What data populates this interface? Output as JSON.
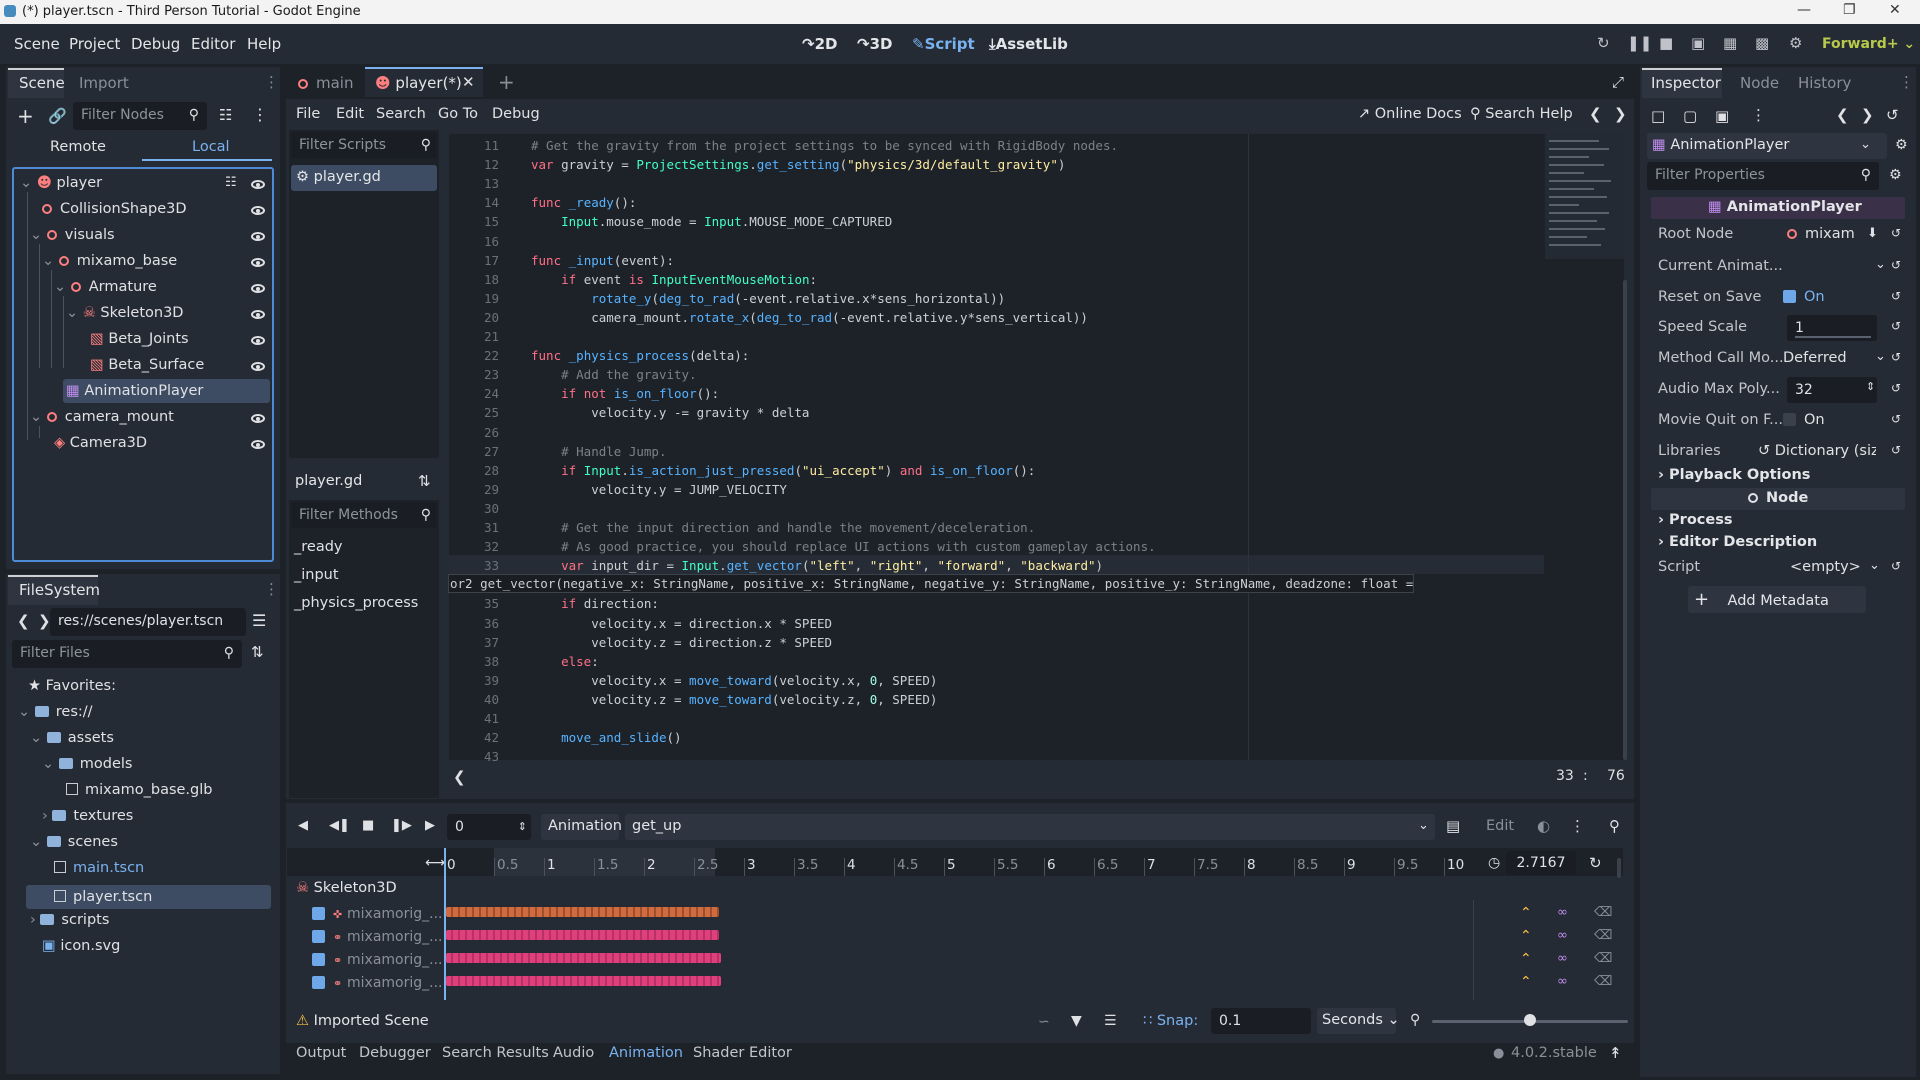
{
  "window": {
    "title": "(*) player.tscn - Third Person Tutorial - Godot Engine"
  },
  "menu": [
    "Scene",
    "Project",
    "Debug",
    "Editor",
    "Help"
  ],
  "workspaces": [
    "2D",
    "3D",
    "Script",
    "AssetLib"
  ],
  "renderer": "Forward+",
  "scene_dock": {
    "tabs": [
      "Scene",
      "Import"
    ],
    "filter_placeholder": "Filter Nodes",
    "remote": "Remote",
    "local": "Local",
    "nodes": [
      "player",
      "CollisionShape3D",
      "visuals",
      "mixamo_base",
      "Armature",
      "Skeleton3D",
      "Beta_Joints",
      "Beta_Surface",
      "AnimationPlayer",
      "camera_mount",
      "Camera3D"
    ]
  },
  "filesystem": {
    "tab": "FileSystem",
    "path": "res://scenes/player.tscn",
    "filter_placeholder": "Filter Files",
    "items": [
      "Favorites:",
      "res://",
      "assets",
      "models",
      "mixamo_base.glb",
      "textures",
      "scenes",
      "main.tscn",
      "player.tscn",
      "scripts",
      "icon.svg"
    ]
  },
  "editor_tabs": [
    "main",
    "player(*)"
  ],
  "script_menu": [
    "File",
    "Edit",
    "Search",
    "Go To",
    "Debug"
  ],
  "online_docs": "Online Docs",
  "search_help": "Search Help",
  "scripts_panel": {
    "filter_placeholder": "Filter Scripts",
    "script": "player.gd",
    "current": "player.gd",
    "methods_placeholder": "Filter Methods",
    "methods": [
      "_ready",
      "_input",
      "_physics_process"
    ]
  },
  "code": {
    "lines": [
      {
        "n": "11",
        "t": "# Get the gravity from the project settings to be synced with RigidBody nodes."
      },
      {
        "n": "12",
        "t": "var gravity = ProjectSettings.get_setting(\"physics/3d/default_gravity\")"
      },
      {
        "n": "13",
        "t": ""
      },
      {
        "n": "14",
        "t": "func _ready():"
      },
      {
        "n": "15",
        "t": "    Input.mouse_mode = Input.MOUSE_MODE_CAPTURED"
      },
      {
        "n": "16",
        "t": ""
      },
      {
        "n": "17",
        "t": "func _input(event):"
      },
      {
        "n": "18",
        "t": "    if event is InputEventMouseMotion:"
      },
      {
        "n": "19",
        "t": "        rotate_y(deg_to_rad(-event.relative.x*sens_horizontal))"
      },
      {
        "n": "20",
        "t": "        camera_mount.rotate_x(deg_to_rad(-event.relative.y*sens_vertical))"
      },
      {
        "n": "21",
        "t": ""
      },
      {
        "n": "22",
        "t": "func _physics_process(delta):"
      },
      {
        "n": "23",
        "t": "    # Add the gravity."
      },
      {
        "n": "24",
        "t": "    if not is_on_floor():"
      },
      {
        "n": "25",
        "t": "        velocity.y -= gravity * delta"
      },
      {
        "n": "26",
        "t": ""
      },
      {
        "n": "27",
        "t": "    # Handle Jump."
      },
      {
        "n": "28",
        "t": "    if Input.is_action_just_pressed(\"ui_accept\") and is_on_floor():"
      },
      {
        "n": "29",
        "t": "        velocity.y = JUMP_VELOCITY"
      },
      {
        "n": "30",
        "t": ""
      },
      {
        "n": "31",
        "t": "    # Get the input direction and handle the movement/deceleration."
      },
      {
        "n": "32",
        "t": "    # As good practice, you should replace UI actions with custom gameplay actions."
      },
      {
        "n": "33",
        "t": "    var input_dir = Input.get_vector(\"left\", \"right\", \"forward\", \"backward\")"
      },
      {
        "n": "",
        "t": ""
      },
      {
        "n": "35",
        "t": "    if direction:"
      },
      {
        "n": "36",
        "t": "        velocity.x = direction.x * SPEED"
      },
      {
        "n": "37",
        "t": "        velocity.z = direction.z * SPEED"
      },
      {
        "n": "38",
        "t": "    else:"
      },
      {
        "n": "39",
        "t": "        velocity.x = move_toward(velocity.x, 0, SPEED)"
      },
      {
        "n": "40",
        "t": "        velocity.z = move_toward(velocity.z, 0, SPEED)"
      },
      {
        "n": "41",
        "t": ""
      },
      {
        "n": "42",
        "t": "    move_and_slide()"
      },
      {
        "n": "43",
        "t": ""
      }
    ],
    "hint": "or2 get_vector(negative_x: StringName, positive_x: StringName, negative_y: StringName, positive_y: StringName, deadzone: float = -1.0)",
    "cursor_line": "33",
    "cursor_col": "76"
  },
  "animation": {
    "time": "0",
    "anim_button": "Animation",
    "current": "get_up",
    "edit": "Edit",
    "ticks": [
      "0",
      "0.5",
      "1",
      "1.5",
      "2",
      "2.5",
      "3",
      "3.5",
      "4",
      "4.5",
      "5",
      "5.5",
      "6",
      "6.5",
      "7",
      "7.5",
      "8",
      "8.5",
      "9",
      "9.5",
      "10"
    ],
    "length": "2.7167",
    "track_group": "Skeleton3D",
    "tracks": [
      "mixamorig_...",
      "mixamorig_...",
      "mixamorig_...",
      "mixamorig_..."
    ],
    "imported_scene": "Imported Scene",
    "snap_label": "Snap:",
    "snap_value": "0.1",
    "snap_unit": "Seconds"
  },
  "bottom_tabs": [
    "Output",
    "Debugger",
    "Search Results",
    "Audio",
    "Animation",
    "Shader Editor"
  ],
  "version": "4.0.2.stable",
  "inspector": {
    "tabs": [
      "Inspector",
      "Node",
      "History"
    ],
    "object": "AnimationPlayer",
    "filter_placeholder": "Filter Properties",
    "header": "AnimationPlayer",
    "props": [
      {
        "name": "Root Node",
        "value": "mixam"
      },
      {
        "name": "Current Animat...",
        "value": ""
      },
      {
        "name": "Reset on Save",
        "value": "On"
      },
      {
        "name": "Speed Scale",
        "value": "1"
      },
      {
        "name": "Method Call Mo...",
        "value": "Deferred"
      },
      {
        "name": "Audio Max Poly...",
        "value": "32"
      },
      {
        "name": "Movie Quit on F...",
        "value": "On"
      },
      {
        "name": "Libraries",
        "value": "Dictionary (siz"
      }
    ],
    "playback": "Playback Options",
    "node_header": "Node",
    "process": "Process",
    "editor_description": "Editor Description",
    "script_label": "Script",
    "script_value": "<empty>",
    "add_metadata": "Add Metadata"
  }
}
